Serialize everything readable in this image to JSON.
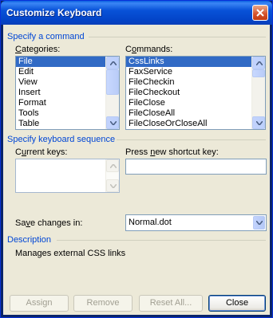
{
  "window": {
    "title": "Customize Keyboard"
  },
  "command_group": {
    "label": "Specify a command",
    "categories_label": "Categories:",
    "categories": [
      "File",
      "Edit",
      "View",
      "Insert",
      "Format",
      "Tools",
      "Table"
    ],
    "commands_label": "Commands:",
    "commands": [
      "CssLinks",
      "FaxService",
      "FileCheckin",
      "FileCheckout",
      "FileClose",
      "FileCloseAll",
      "FileCloseOrCloseAll"
    ]
  },
  "sequence_group": {
    "label": "Specify keyboard sequence",
    "current_keys_label": "Current keys:",
    "new_key_label": "Press new shortcut key:",
    "new_key_value": ""
  },
  "save_in": {
    "label": "Save changes in:",
    "value": "Normal.dot"
  },
  "description": {
    "label": "Description",
    "text": "Manages external CSS links"
  },
  "buttons": {
    "assign": "Assign",
    "remove": "Remove",
    "reset_all": "Reset All...",
    "close": "Close"
  }
}
